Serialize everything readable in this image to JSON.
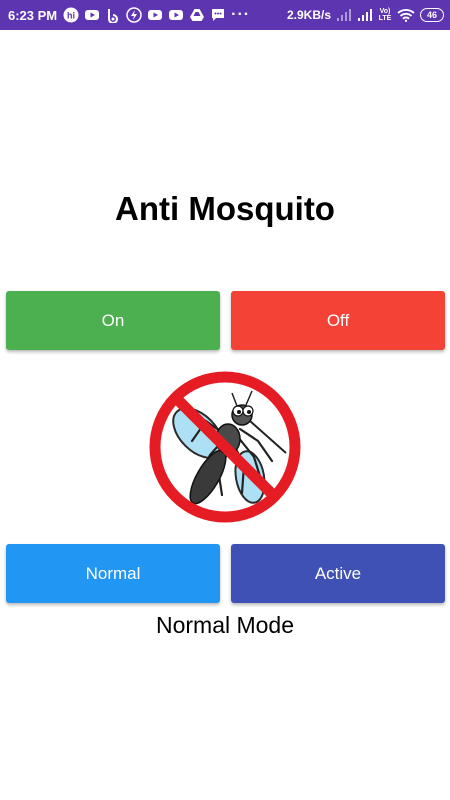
{
  "status_bar": {
    "time": "6:23 PM",
    "notifications": [
      "hi-icon",
      "youtube-icon",
      "b-icon",
      "lightning-icon",
      "youtube-icon",
      "youtube-icon",
      "drive-icon",
      "chat-icon"
    ],
    "more": "···",
    "net_speed": "2.9KB/s",
    "volte_top": "Vo)",
    "volte_bottom": "LTE",
    "battery": "46",
    "colors": {
      "background": "#5e35b1",
      "foreground": "#ffffff"
    }
  },
  "app": {
    "title": "Anti Mosquito",
    "buttons": {
      "on": "On",
      "off": "Off",
      "normal": "Normal",
      "active": "Active"
    },
    "mode_label": "Normal Mode",
    "image": "no-mosquito-icon",
    "colors": {
      "on": "#4caf50",
      "off": "#f44336",
      "normal": "#2196f3",
      "active": "#3f51b5"
    }
  }
}
